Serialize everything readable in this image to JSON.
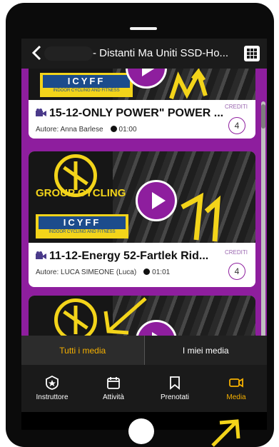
{
  "header": {
    "title": "- Distanti Ma Uniti SSD-Ho...",
    "back_icon": "chevron-left-icon",
    "grid_icon": "grid-icon"
  },
  "videos": [
    {
      "title": "15-12-ONLY POWER\" POWER ...",
      "author": "Autore: Anna Barlese",
      "duration": "01:00",
      "credits_label": "CREDITI",
      "credits": "4",
      "logo_text": "ICYFF",
      "logo_sub": "INDOOR CYCLING AND FITNESS"
    },
    {
      "title": "11-12-Energy 52-Fartlek Rid...",
      "author": "Autore: LUCA SIMEONE (Luca)",
      "duration": "01:01",
      "credits_label": "CREDITI",
      "credits": "4",
      "group_text": "GROUP CYCLING",
      "logo_text": "ICYFF",
      "logo_sub": "INDOOR CYCLING AND FITNESS"
    }
  ],
  "tabs": [
    {
      "label": "Tutti i media",
      "active": true
    },
    {
      "label": "I miei media",
      "active": false
    }
  ],
  "bottom_nav": [
    {
      "label": "Instruttore",
      "icon": "badge-icon",
      "active": false
    },
    {
      "label": "Attività",
      "icon": "calendar-icon",
      "active": false
    },
    {
      "label": "Prenotati",
      "icon": "bookmark-icon",
      "active": false
    },
    {
      "label": "Media",
      "icon": "video-icon",
      "active": true
    }
  ],
  "colors": {
    "brand_purple": "#8e1e9e",
    "active_orange": "#f5b000",
    "annotation_yellow": "#f3d41a"
  }
}
